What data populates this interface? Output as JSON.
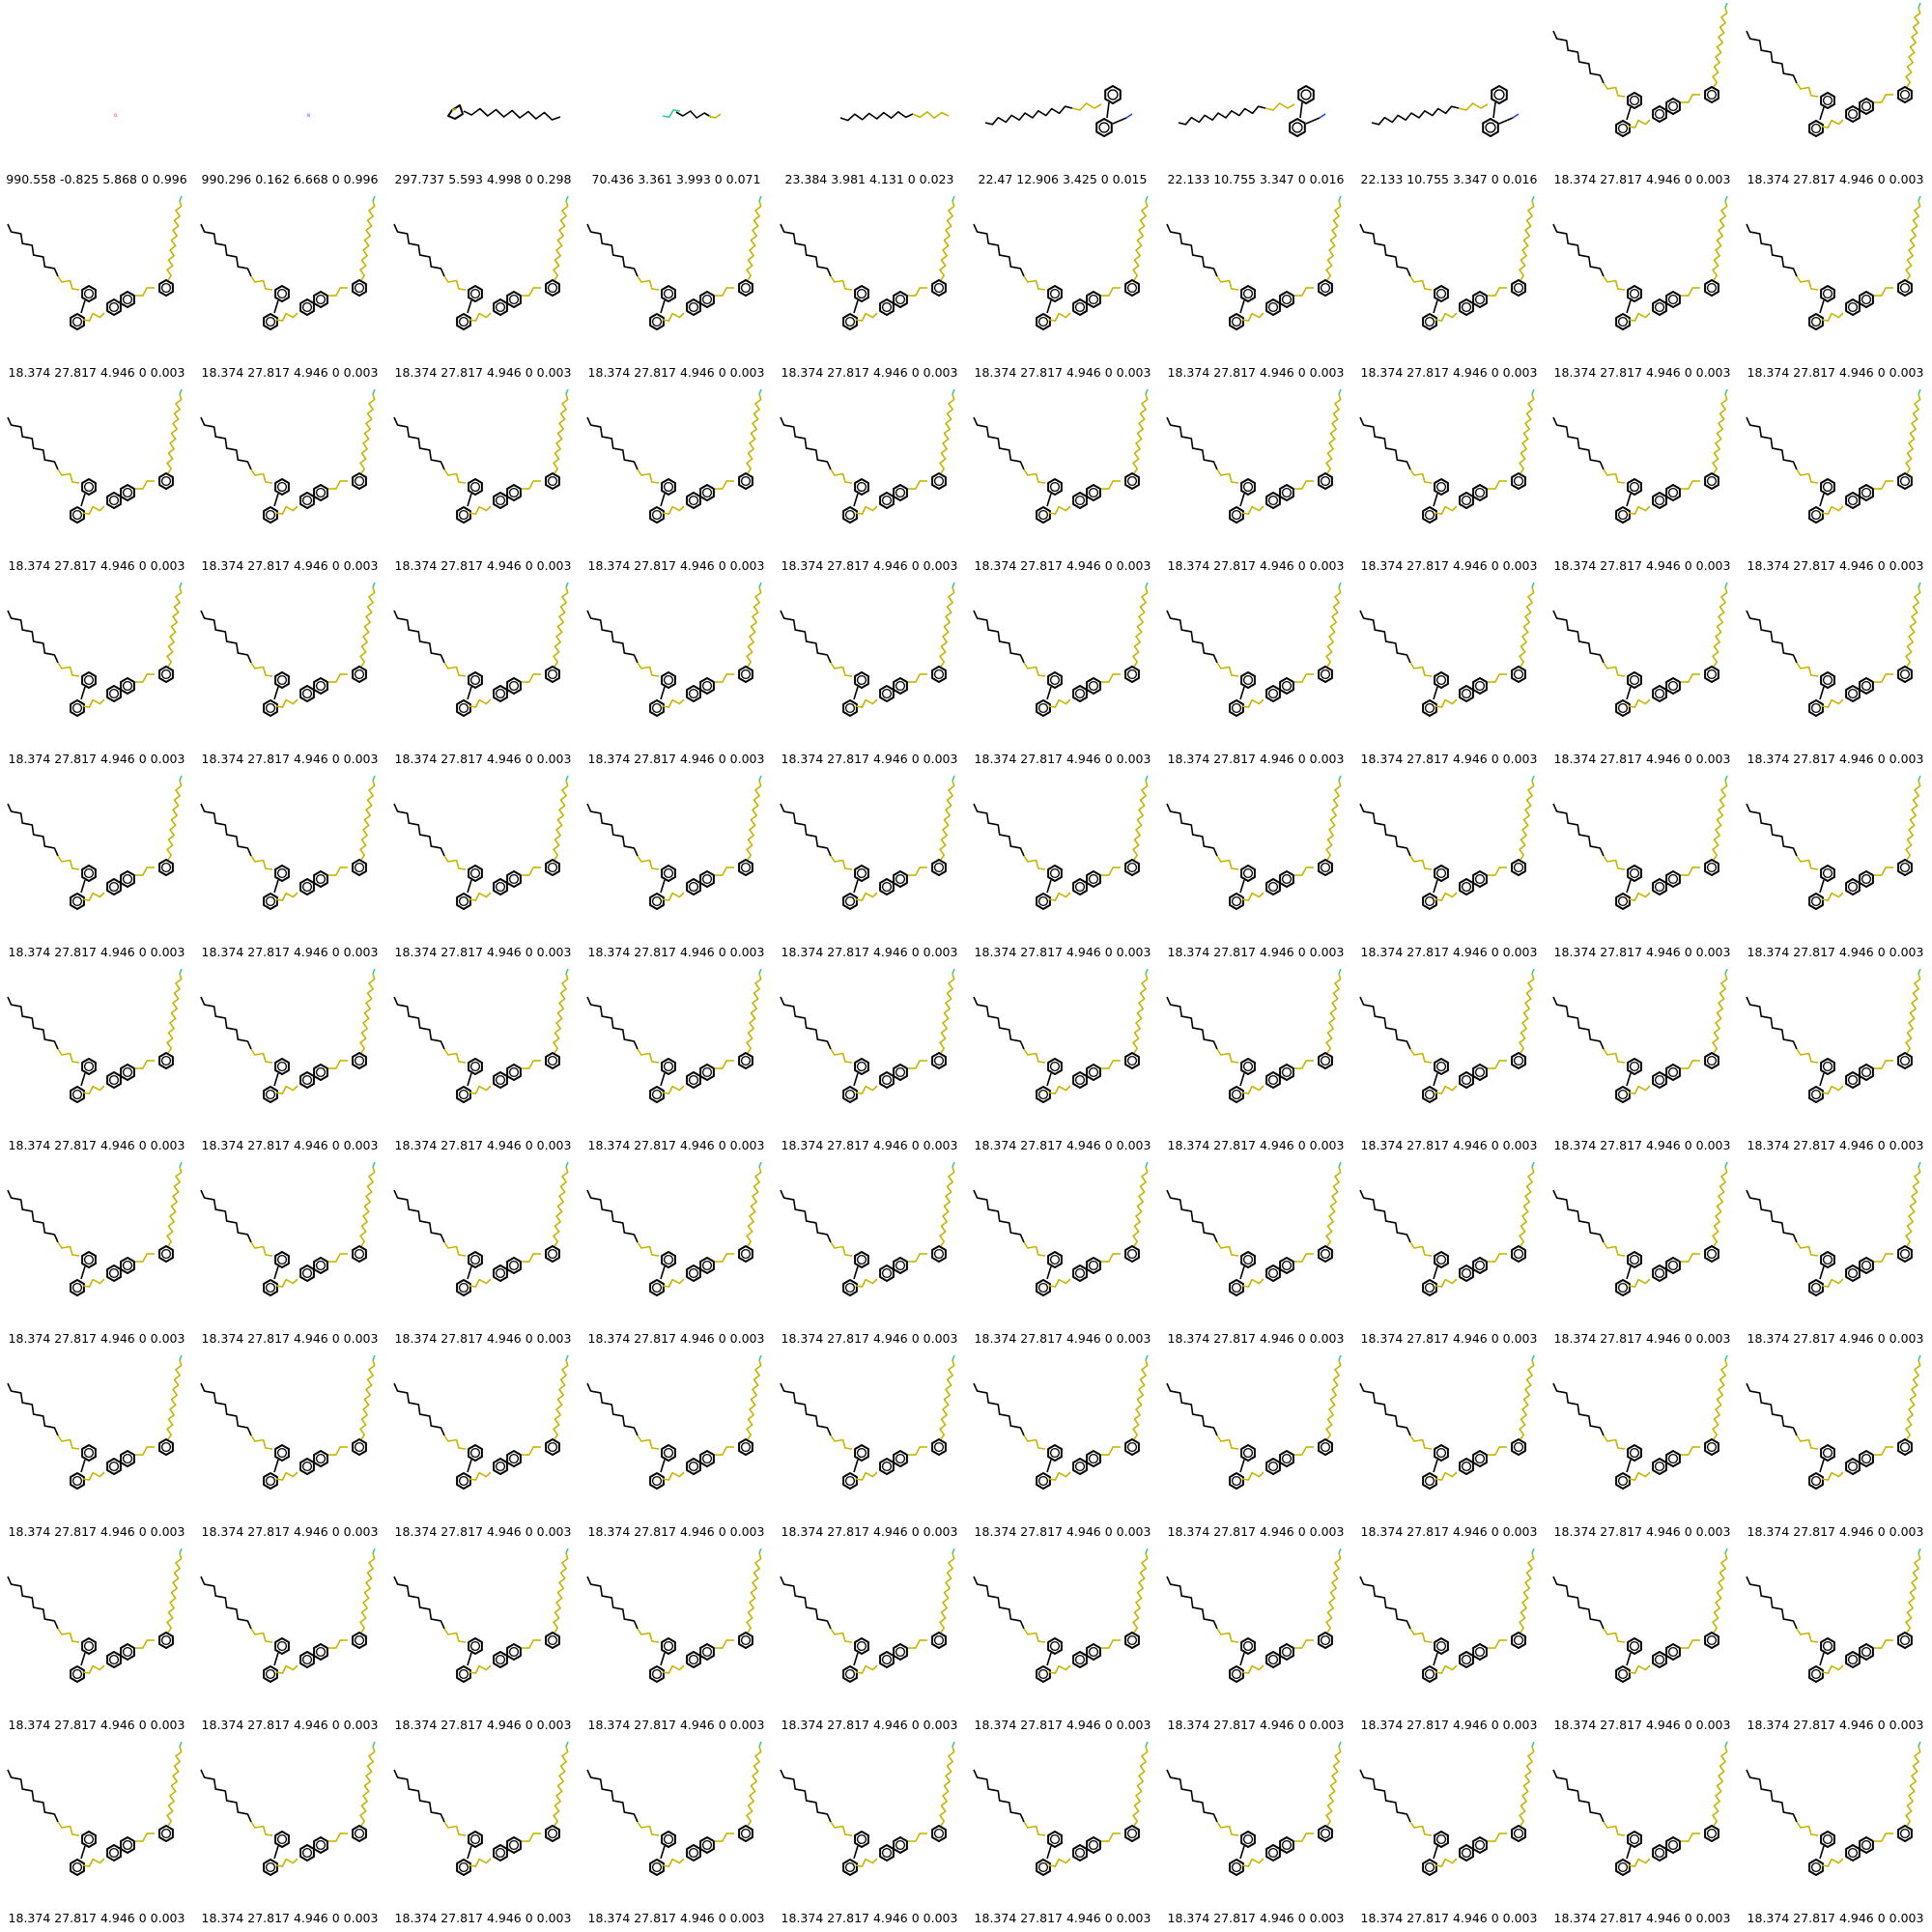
{
  "grid": {
    "columns": 10,
    "rows": 10,
    "cells": [
      {
        "caption": "990.558 -0.825 5.868 0 0.996",
        "molecule": "tiny-fragment",
        "atom_label": "O"
      },
      {
        "caption": "990.296 0.162 6.668 0 0.996",
        "molecule": "tiny-fragment",
        "atom_label": "N"
      },
      {
        "caption": "297.737 5.593 4.998 0 0.298",
        "molecule": "thiophene-alkyl"
      },
      {
        "caption": "70.436 3.361 3.993 0 0.071",
        "molecule": "short-chain"
      },
      {
        "caption": "23.384 3.981 4.131 0 0.023",
        "molecule": "long-chain"
      },
      {
        "caption": "22.47 12.906 3.425 0 0.015",
        "molecule": "chain-diaryl"
      },
      {
        "caption": "22.133 10.755 3.347 0 0.016",
        "molecule": "chain-diaryl"
      },
      {
        "caption": "22.133 10.755 3.347 0 0.016",
        "molecule": "chain-diaryl"
      },
      {
        "caption": "18.374 27.817 4.946 0 0.003",
        "molecule": "big"
      },
      {
        "caption": "18.374 27.817 4.946 0 0.003",
        "molecule": "big"
      }
    ],
    "repeat_cell": {
      "caption": "18.374 27.817 4.946 0 0.003",
      "molecule": "big"
    }
  },
  "colors": {
    "bond": "#000000",
    "sulfur": "#c8b400",
    "oxygen": "#ff0000",
    "nitrogen": "#1f3cff",
    "fluorine": "#33cc99"
  }
}
